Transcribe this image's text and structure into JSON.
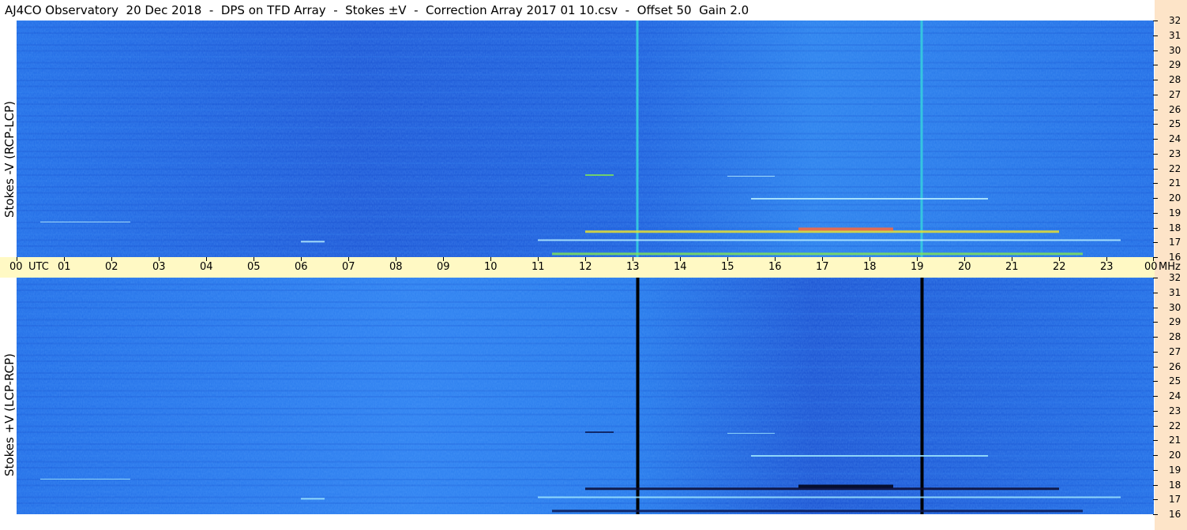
{
  "title": "AJ4CO Observatory  20 Dec 2018  -  DPS on TFD Array  -  Stokes ±V  -  Correction Array 2017 01 10.csv  -  Offset 50  Gain 2.0",
  "colors": {
    "background_plot": "#1e64e6",
    "strip_right": "#fde4c8",
    "time_band": "#fff9c4"
  },
  "chart_data": [
    {
      "type": "heatmap",
      "ylabel": "Stokes -V (RCP-LCP)",
      "y_unit": "MHz",
      "y_ticks": [
        "32",
        "31",
        "30",
        "29",
        "28",
        "27",
        "26",
        "25",
        "24",
        "23",
        "22",
        "21",
        "20",
        "19",
        "18",
        "17",
        "16"
      ],
      "ylim": [
        16,
        32
      ],
      "xlim": [
        0,
        24
      ],
      "vertical_lines_utc": [
        13.1,
        19.1
      ],
      "vertical_line_color": "#35c5e0"
    },
    {
      "type": "heatmap",
      "ylabel": "Stokes +V (LCP-RCP)",
      "y_unit": "MHz",
      "y_ticks": [
        "32",
        "31",
        "30",
        "29",
        "28",
        "27",
        "26",
        "25",
        "24",
        "23",
        "22",
        "21",
        "20",
        "19",
        "18",
        "17",
        "16"
      ],
      "ylim": [
        16,
        32
      ],
      "xlim": [
        0,
        24
      ],
      "vertical_lines_utc": [
        13.1,
        19.1
      ],
      "vertical_line_color": "#000000"
    }
  ],
  "time_axis": {
    "labels": [
      "00",
      "01",
      "02",
      "03",
      "04",
      "05",
      "06",
      "07",
      "08",
      "09",
      "10",
      "11",
      "12",
      "13",
      "14",
      "15",
      "16",
      "17",
      "18",
      "19",
      "20",
      "21",
      "22",
      "23",
      "00"
    ],
    "utc_label": "UTC",
    "unit_label": "MHz"
  }
}
